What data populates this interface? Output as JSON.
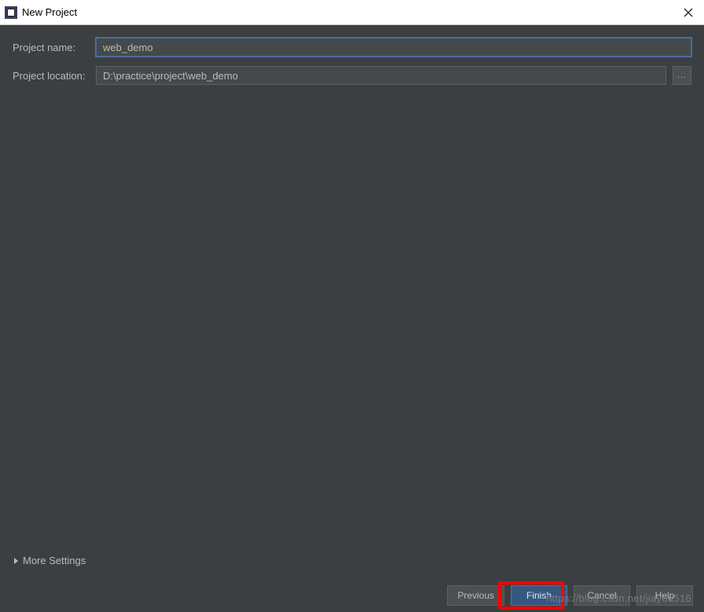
{
  "titlebar": {
    "title": "New Project"
  },
  "form": {
    "project_name_label": "Project name:",
    "project_name_value": "web_demo",
    "project_location_label": "Project location:",
    "project_location_value": "D:\\practice\\project\\web_demo",
    "browse_label": "..."
  },
  "more_settings_label": "More Settings",
  "buttons": {
    "previous": "Previous",
    "finish": "Finish",
    "cancel": "Cancel",
    "help": "Help"
  },
  "watermark": "https://blog.csdn.net/jiayou516"
}
